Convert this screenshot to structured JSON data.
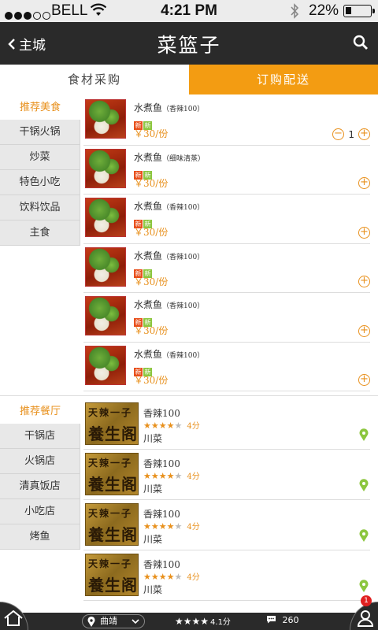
{
  "status_bar": {
    "carrier": "BELL",
    "time": "4:21 PM",
    "battery": "22%"
  },
  "nav": {
    "back_label": "主城",
    "title": "菜篮子"
  },
  "tabs": [
    {
      "label": "食材采购"
    },
    {
      "label": "订购配送",
      "active": true
    }
  ],
  "food_categories": {
    "header": "推荐美食",
    "items": [
      {
        "label": "干锅火锅"
      },
      {
        "label": "炒菜"
      },
      {
        "label": "特色小吃"
      },
      {
        "label": "饮料饮品"
      },
      {
        "label": "主食"
      }
    ]
  },
  "food_items": [
    {
      "name": "水煮鱼",
      "variant": "（香辣100）",
      "tags": [
        "新",
        "新"
      ],
      "price": "￥30/份",
      "qty": "1"
    },
    {
      "name": "水煮鱼",
      "variant": "（细味清蒸）",
      "tags": [
        "新",
        "新"
      ],
      "price": "￥30/份"
    },
    {
      "name": "水煮鱼",
      "variant": "（香辣100）",
      "tags": [
        "新",
        "新"
      ],
      "price": "￥30/份"
    },
    {
      "name": "水煮鱼",
      "variant": "（香辣100）",
      "tags": [
        "新",
        "新"
      ],
      "price": "￥30/份"
    },
    {
      "name": "水煮鱼",
      "variant": "（香辣100）",
      "tags": [
        "新",
        "新"
      ],
      "price": "￥30/份"
    },
    {
      "name": "水煮鱼",
      "variant": "（香辣100）",
      "tags": [
        "新",
        "新"
      ],
      "price": "￥30/份"
    }
  ],
  "shop_categories": {
    "header": "推荐餐厅",
    "items": [
      {
        "label": "干锅店"
      },
      {
        "label": "火锅店"
      },
      {
        "label": "清真饭店"
      },
      {
        "label": "小吃店"
      },
      {
        "label": "烤鱼"
      }
    ]
  },
  "shops": [
    {
      "name": "香辣100",
      "rating": 4,
      "score": "4分",
      "cuisine": "川菜",
      "logo_line1": "天辣一子",
      "logo_line2": "養生阁"
    },
    {
      "name": "香辣100",
      "rating": 4,
      "score": "4分",
      "cuisine": "川菜",
      "logo_line1": "天辣一子",
      "logo_line2": "養生阁"
    },
    {
      "name": "香辣100",
      "rating": 4,
      "score": "4分",
      "cuisine": "川菜",
      "logo_line1": "天辣一子",
      "logo_line2": "養生阁"
    },
    {
      "name": "香辣100",
      "rating": 4,
      "score": "4分",
      "cuisine": "川菜",
      "logo_line1": "天辣一子",
      "logo_line2": "養生阁"
    }
  ],
  "bottom_bar": {
    "location": "曲靖",
    "stars": "★★★★",
    "score": "4.1分",
    "comments": "260",
    "notification_count": "1"
  },
  "colors": {
    "accent": "#f39c12",
    "dark": "#2a2a2a",
    "price": "#e8901c",
    "pin": "#8cc63f"
  }
}
